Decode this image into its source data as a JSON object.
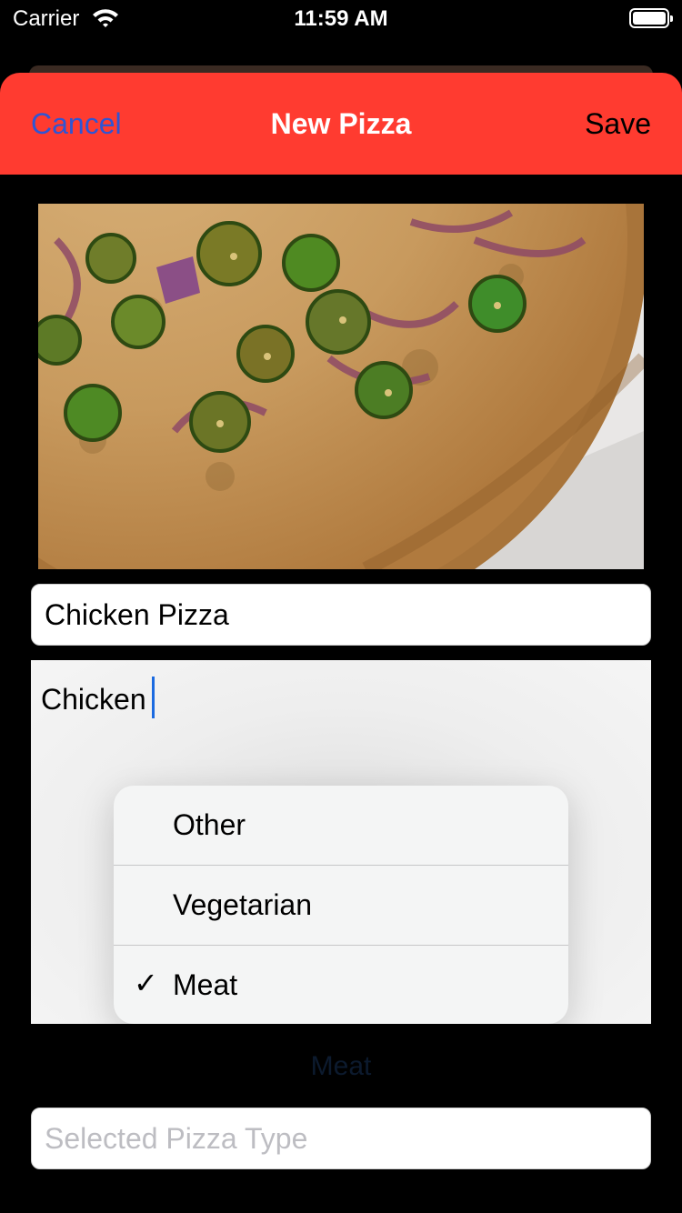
{
  "status_bar": {
    "carrier": "Carrier",
    "time": "11:59 AM"
  },
  "nav": {
    "cancel_label": "Cancel",
    "title": "New Pizza",
    "save_label": "Save",
    "background_color": "#ff3b30",
    "cancel_color": "#2f55d4"
  },
  "form": {
    "name_value": "Chicken Pizza",
    "description_value": "Chicken",
    "type_menu": {
      "options": [
        "Other",
        "Vegetarian",
        "Meat"
      ],
      "checked": "Meat"
    },
    "selected_type_label": "Meat",
    "type_field_placeholder": "Selected Pizza Type"
  },
  "icons": {
    "wifi": "wifi-icon",
    "battery": "battery-icon",
    "checkmark": "checkmark-icon"
  }
}
